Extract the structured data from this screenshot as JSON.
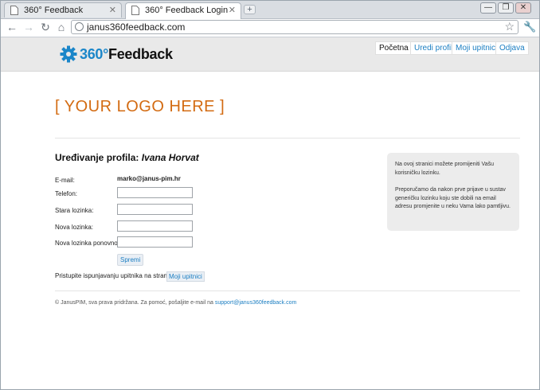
{
  "browser": {
    "tabs": [
      {
        "title": "360° Feedback",
        "active": false
      },
      {
        "title": "360° Feedback Login",
        "active": true
      }
    ],
    "url": "janus360feedback.com"
  },
  "header": {
    "brand_number": "360°",
    "brand_word": "Feedback",
    "nav": [
      {
        "label": "Početna",
        "current": true
      },
      {
        "label": "Uredi profil",
        "current": false
      },
      {
        "label": "Moji upitnici",
        "current": false
      },
      {
        "label": "Odjava",
        "current": false
      }
    ]
  },
  "placeholder_logo": "[ YOUR LOGO HERE ]",
  "profile": {
    "title_prefix": "Uređivanje profila:",
    "user_name": "Ivana Horvat",
    "email_label": "E-mail:",
    "email_value": "marko@janus-pim.hr",
    "phone_label": "Telefon:",
    "phone_value": "",
    "old_password_label": "Stara lozinka:",
    "old_password_value": "",
    "new_password_label": "Nova lozinka:",
    "new_password_value": "",
    "repeat_password_label": "Nova lozinka ponovno:",
    "repeat_password_value": "",
    "save_label": "Spremi"
  },
  "hint": {
    "text": "Pristupite ispunjavanju upitnika na stranici",
    "link": "Moji upitnici"
  },
  "info": {
    "p1": "Na ovoj stranici možete promijeniti Vašu korisničku lozinku.",
    "p2": "Preporučamo da nakon prve prijave u sustav generičku lozinku koju ste dobili na email adresu promjenite u neku Vama lako pamtljivu."
  },
  "footer": {
    "text": "© JanusPIM, sva prava pridržana. Za pomoć, pošaljite e-mail na",
    "email": "support@janus360feedback.com"
  },
  "colors": {
    "brand_blue": "#1b86c9",
    "link_blue": "#1b7ec2",
    "logo_orange": "#d36b12",
    "header_bg": "#e9e9e9"
  }
}
